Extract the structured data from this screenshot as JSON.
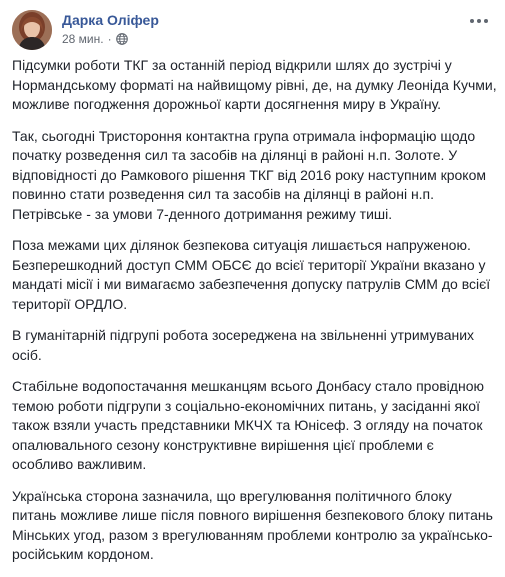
{
  "post": {
    "author": "Дарка Оліфер",
    "time": "28 мин.",
    "separator": "·",
    "avatar_icon": "profile-photo",
    "audience_icon": "globe-icon",
    "menu_icon": "more-options-icon",
    "paragraphs": [
      "Підсумки роботи ТКГ за останній період відкрили шлях до зустрічі у Нормандському форматі на найвищому рівні, де, на думку Леоніда Кучми, можливе погодження дорожньої карти досягнення миру в Україну.",
      "Так, сьогодні Тристороння контактна група отримала інформацію щодо початку розведення сил та засобів на ділянці в районі н.п. Золоте. У відповідності до Рамкового рішення ТКГ від 2016 року наступним кроком повинно стати розведення сил та засобів на ділянці в районі н.п. Петрівське - за умови 7-денного дотримання режиму тиші.",
      "Поза межами цих ділянок безпекова ситуація лишається напруженою. Безперешкодний доступ СММ ОБСЄ до всієї території України вказано у мандаті місії і ми вимагаємо забезпечення допуску патрулів СММ до всієї території ОРДЛО.",
      "В гуманітарній підгрупі робота зосереджена на звільненні утримуваних осіб.",
      "Стабільне водопостачання мешканцям всього Донбасу стало провідною темою роботи підгрупи з соціально-економічних питань, у засіданні якої також взяли участь представники МКЧХ та Юнісеф. З огляду на початок опалювального сезону конструктивне вирішення цієї проблеми є особливо важливим.",
      "Українська сторона зазначила, що врегулювання політичного блоку питань можливе лише після повного вирішення безпекового блоку питань Мінських угод, разом з врегулюванням проблеми контролю за українсько-російським кордоном."
    ]
  },
  "colors": {
    "author": "#385898",
    "meta": "#616770",
    "text": "#1d2129"
  }
}
